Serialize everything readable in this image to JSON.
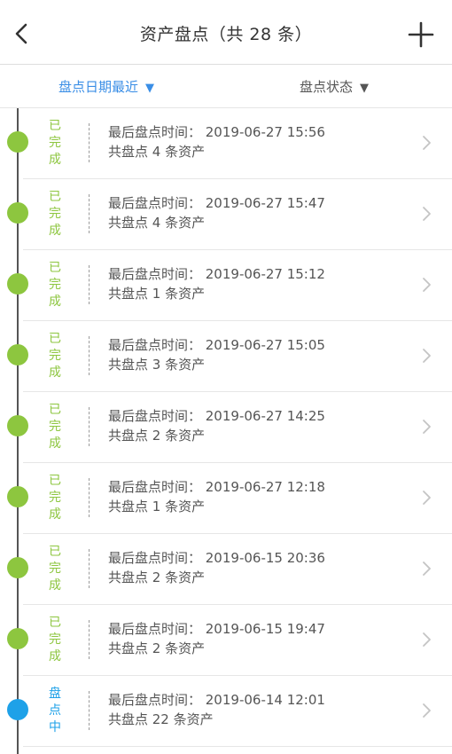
{
  "header": {
    "title": "资产盘点（共 28 条）",
    "back_icon": "chevron-left-icon",
    "add_icon": "plus-icon"
  },
  "filters": {
    "date_sort_label": "盘点日期最近",
    "status_label": "盘点状态",
    "arrow": "▼"
  },
  "colors": {
    "done": "#8dc63f",
    "in_progress": "#1ea1e8",
    "accent_blue": "#3a8ee6"
  },
  "records": [
    {
      "status": "已完成",
      "state": "done",
      "last_time": "最后盘点时间：  2019-06-27 15:56",
      "count": "共盘点 4 条资产"
    },
    {
      "status": "已完成",
      "state": "done",
      "last_time": "最后盘点时间：  2019-06-27 15:47",
      "count": "共盘点 4 条资产"
    },
    {
      "status": "已完成",
      "state": "done",
      "last_time": "最后盘点时间：  2019-06-27 15:12",
      "count": "共盘点 1 条资产"
    },
    {
      "status": "已完成",
      "state": "done",
      "last_time": "最后盘点时间：  2019-06-27 15:05",
      "count": "共盘点 3 条资产"
    },
    {
      "status": "已完成",
      "state": "done",
      "last_time": "最后盘点时间：  2019-06-27 14:25",
      "count": "共盘点 2 条资产"
    },
    {
      "status": "已完成",
      "state": "done",
      "last_time": "最后盘点时间：  2019-06-27 12:18",
      "count": "共盘点 1 条资产"
    },
    {
      "status": "已完成",
      "state": "done",
      "last_time": "最后盘点时间：  2019-06-15 20:36",
      "count": "共盘点 2 条资产"
    },
    {
      "status": "已完成",
      "state": "done",
      "last_time": "最后盘点时间：  2019-06-15 19:47",
      "count": "共盘点 2 条资产"
    },
    {
      "status": "盘点中",
      "state": "in_progress",
      "last_time": "最后盘点时间：  2019-06-14 12:01",
      "count": "共盘点 22 条资产"
    }
  ]
}
